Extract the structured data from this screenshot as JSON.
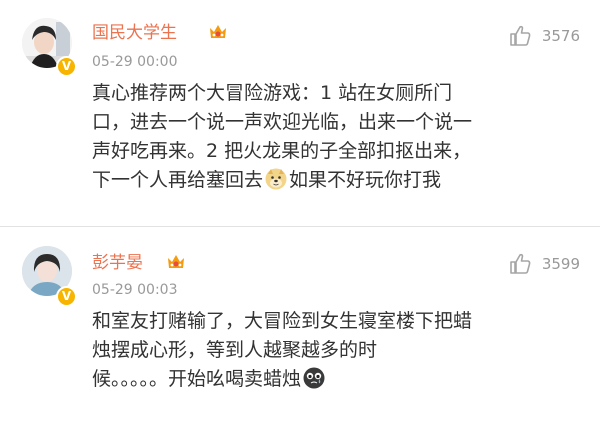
{
  "comments": [
    {
      "username": "国民大学生",
      "verified_badge": "V",
      "timestamp": "05-29 00:00",
      "likes": "3576",
      "text_lines": [
        "真心推荐两个大冒险游戏：1 站在女厕所门",
        "口，进去一个说一声欢迎光临，出来一个说一",
        "声好吃再来。2 把火龙果的子全部扣抠出来，"
      ],
      "last_line_before_emoji": "下一个人再给塞回去",
      "emoji": "doge-emoji",
      "last_line_after_emoji": "如果不好玩你打我"
    },
    {
      "username": "彭芋晏",
      "verified_badge": "V",
      "timestamp": "05-29 00:03",
      "likes": "3599",
      "text_lines": [
        "和室友打赌输了，大冒险到女生寝室楼下把蜡",
        "烛摆成心形，等到人越聚越多的时"
      ],
      "last_line_before_emoji": "候。。。。。开始吆喝卖蜡烛",
      "emoji": "crying-emoji",
      "last_line_after_emoji": ""
    }
  ],
  "colors": {
    "username": "#eb7350",
    "meta_text": "#999999",
    "body_text": "#333333",
    "verified_badge": "#f7b500",
    "divider": "#e2e2e2"
  },
  "icons": [
    "thumbs-up-icon",
    "crown-member-icon",
    "verified-v-icon"
  ]
}
